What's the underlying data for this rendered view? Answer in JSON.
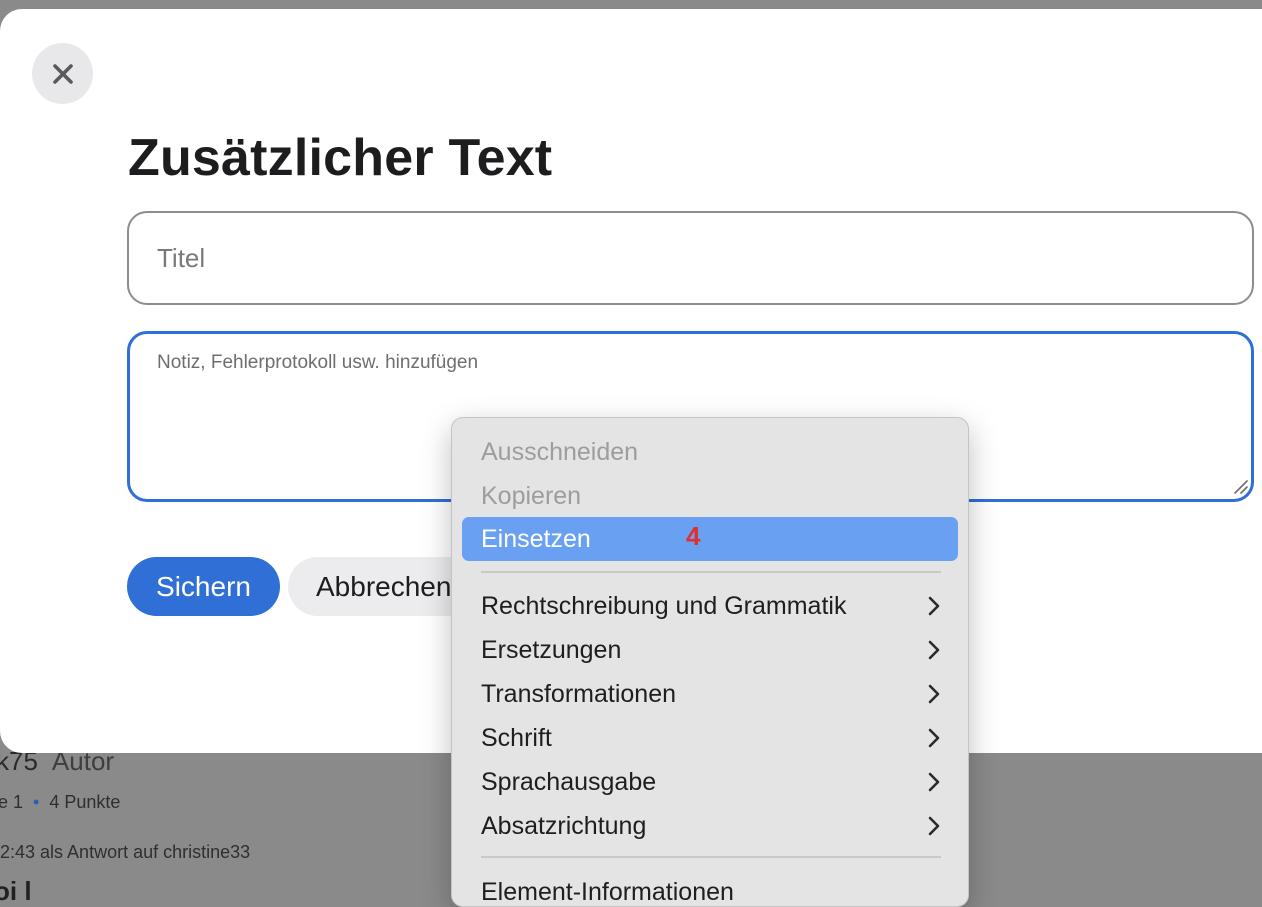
{
  "background": {
    "author_name": "k75",
    "author_role": "Autor",
    "level": "e 1",
    "points": "4 Punkte",
    "reply_info": "l2:43 als Antwort auf christine33",
    "partial_text": "oi l"
  },
  "modal": {
    "title": "Zusätzlicher Text",
    "title_placeholder": "Titel",
    "note_placeholder": "Notiz, Fehlerprotokoll usw. hinzufügen",
    "save_label": "Sichern",
    "cancel_label": "Abbrechen"
  },
  "context_menu": {
    "items": [
      {
        "label": "Ausschneiden",
        "disabled": true
      },
      {
        "label": "Kopieren",
        "disabled": true
      },
      {
        "label": "Einsetzen",
        "highlighted": true,
        "badge": "4"
      },
      {
        "label": "Rechtschreibung und Grammatik",
        "submenu": true
      },
      {
        "label": "Ersetzungen",
        "submenu": true
      },
      {
        "label": "Transformationen",
        "submenu": true
      },
      {
        "label": "Schrift",
        "submenu": true
      },
      {
        "label": "Sprachausgabe",
        "submenu": true
      },
      {
        "label": "Absatzrichtung",
        "submenu": true
      },
      {
        "label": "Element-Informationen"
      }
    ]
  },
  "colors": {
    "accent": "#2f6fd6",
    "highlight": "#6aa0f2",
    "badge": "#e0302b",
    "overlay": "#8a8a8a"
  }
}
